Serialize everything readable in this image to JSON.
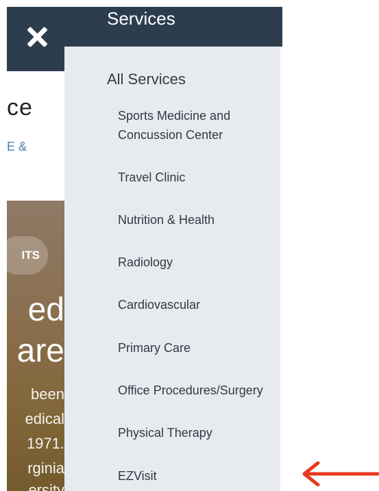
{
  "page": {
    "partial_title": "ce",
    "partial_link": "E &",
    "hero": {
      "pill": "ITS",
      "big_line_1": "ed",
      "big_line_2": "are",
      "small_lines": [
        "been",
        "edical",
        "1971.",
        "rginia",
        "ersity"
      ]
    }
  },
  "menu": {
    "header_title": "Services",
    "all_services": "All Services",
    "items": [
      {
        "label_line1": "Sports Medicine and",
        "label_line2": "Concussion Center"
      },
      {
        "label": "Travel Clinic"
      },
      {
        "label": "Nutrition & Health"
      },
      {
        "label": "Radiology"
      },
      {
        "label": "Cardiovascular"
      },
      {
        "label": "Primary Care"
      },
      {
        "label": "Office Procedures/Surgery"
      },
      {
        "label": "Physical Therapy"
      },
      {
        "label": "EZVisit"
      }
    ]
  },
  "icons": {
    "close": "close-icon",
    "annotation": "red-arrow-icon"
  },
  "colors": {
    "header_bg": "#2c3e4e",
    "panel_bg": "#e7ebef",
    "link": "#4f7fb4",
    "arrow": "#e8381f"
  }
}
